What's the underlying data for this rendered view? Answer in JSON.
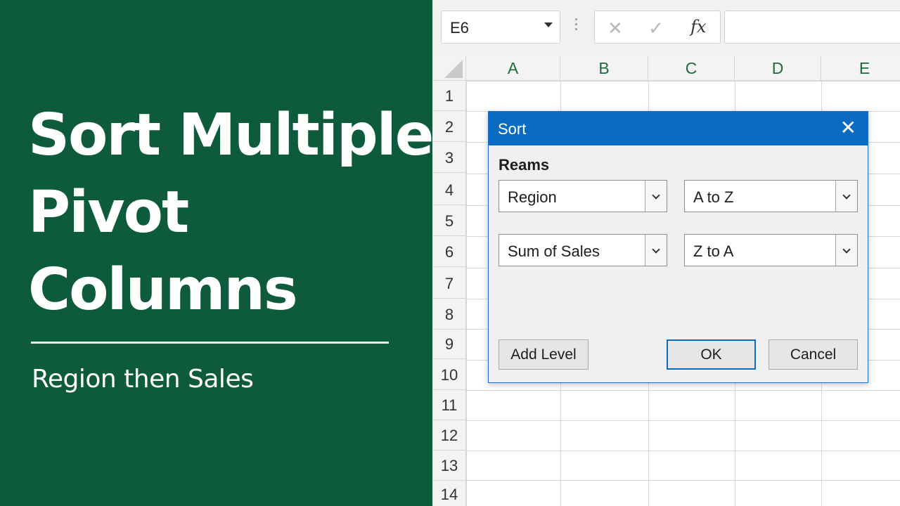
{
  "title_panel": {
    "lines": [
      "Sort Multiple",
      "Pivot",
      "Columns"
    ],
    "subtitle": "Region then Sales",
    "background_color": "#0e5b3c"
  },
  "formula_bar": {
    "name_box_value": "E6",
    "cancel_icon": "x-icon",
    "enter_icon": "check-icon",
    "fx_label": "fx",
    "formula_value": ""
  },
  "sheet": {
    "columns": [
      "A",
      "B",
      "C",
      "D",
      "E"
    ],
    "rows": [
      "1",
      "2",
      "3",
      "4",
      "5",
      "6",
      "7",
      "8",
      "9",
      "10",
      "11",
      "12",
      "13",
      "14"
    ]
  },
  "dialog": {
    "title": "Sort",
    "close_icon": "close-icon",
    "group_label": "Reams",
    "levels": [
      {
        "column": "Region",
        "order": "A to Z"
      },
      {
        "column": "Sum of Sales",
        "order": "Z to A"
      }
    ],
    "add_level_label": "Add Level",
    "ok_label": "OK",
    "cancel_label": "Cancel",
    "accent_color": "#0a6bc3"
  }
}
